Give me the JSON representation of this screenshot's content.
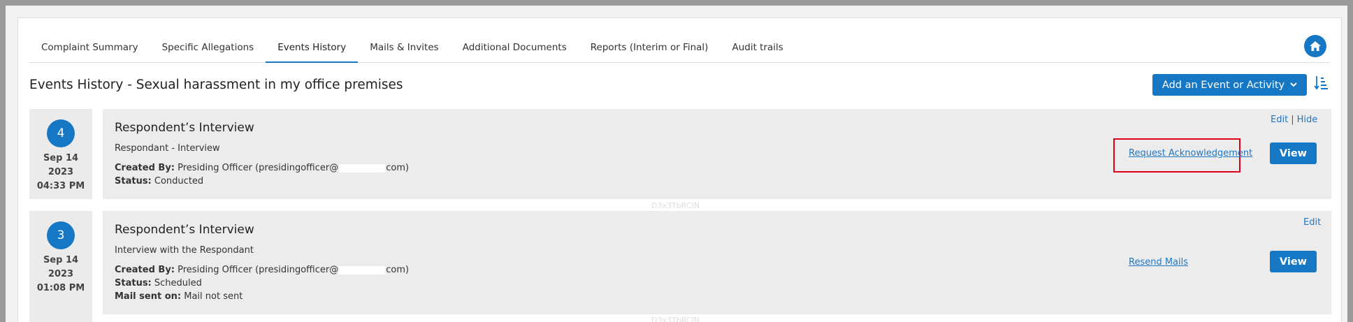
{
  "tabs": [
    {
      "label": "Complaint Summary"
    },
    {
      "label": "Specific Allegations"
    },
    {
      "label": "Events History"
    },
    {
      "label": "Mails & Invites"
    },
    {
      "label": "Additional Documents"
    },
    {
      "label": "Reports (Interim or Final)"
    },
    {
      "label": "Audit trails"
    }
  ],
  "active_tab": "Events History",
  "page_title": "Events History - Sexual harassment in my office premises",
  "add_button_label": "Add an Event or Activity",
  "watermark": "D3x3TbRCIN",
  "events": [
    {
      "number": "4",
      "date": "Sep 14",
      "year": "2023",
      "time": "04:33 PM",
      "title": "Respondent’s Interview",
      "subtitle": "Respondant - Interview",
      "created_by_label": "Created By:",
      "created_by_prefix": "Presiding Officer (presidingofficer@",
      "created_by_suffix": "com)",
      "status_label": "Status:",
      "status": "Conducted",
      "edit_label": "Edit",
      "sep": "|",
      "hide_label": "Hide",
      "action_link": "Request Acknowledgement",
      "view_label": "View"
    },
    {
      "number": "3",
      "date": "Sep 14",
      "year": "2023",
      "time": "01:08 PM",
      "title": "Respondent’s Interview",
      "subtitle": "Interview with the Respondant",
      "created_by_label": "Created By:",
      "created_by_prefix": "Presiding Officer (presidingofficer@",
      "created_by_suffix": "com)",
      "status_label": "Status:",
      "status": "Scheduled",
      "mail_label": "Mail sent on:",
      "mail_value": "Mail not sent",
      "edit_label": "Edit",
      "action_link": "Resend Mails",
      "view_label": "View"
    }
  ],
  "colors": {
    "accent": "#1677c4",
    "highlight": "#e0001b"
  }
}
